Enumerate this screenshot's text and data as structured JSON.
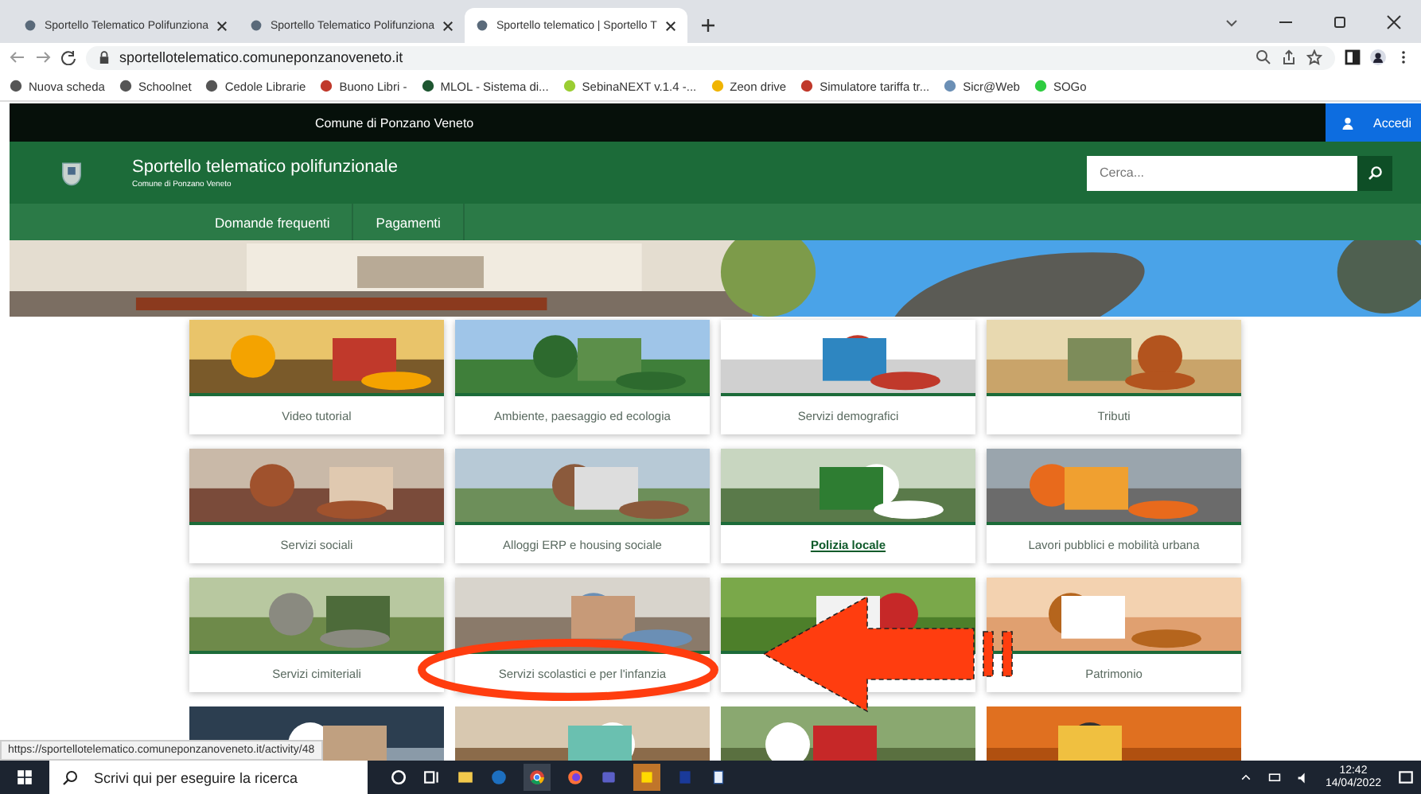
{
  "browser": {
    "tabs": [
      {
        "title": "Sportello Telematico Polifunziona",
        "selected": false
      },
      {
        "title": "Sportello Telematico Polifunziona",
        "selected": false
      },
      {
        "title": "Sportello telematico | Sportello T",
        "selected": true
      }
    ],
    "url": "sportellotelematico.comuneponzanoveneto.it",
    "bookmarks": [
      "Nuova scheda",
      "Schoolnet",
      "Cedole Librarie",
      "Buono Libri -",
      "MLOL - Sistema di...",
      "SebinaNEXT v.1.4 -...",
      "Zeon drive",
      "Simulatore tariffa tr...",
      "Sicr@Web",
      "SOGo"
    ]
  },
  "top_bar": {
    "title": "Comune di Ponzano Veneto",
    "login": "Accedi"
  },
  "header": {
    "title": "Sportello telematico polifunzionale",
    "subtitle": "Comune di Ponzano Veneto",
    "search": {
      "placeholder": "Cerca..."
    }
  },
  "nav": [
    "Domande frequenti",
    "Pagamenti"
  ],
  "tiles": [
    {
      "kind": "tile",
      "label": "Video tutorial",
      "hovered": false
    },
    {
      "kind": "tile",
      "label": "Ambiente, paesaggio ed ecologia",
      "hovered": false
    },
    {
      "kind": "tile",
      "label": "Servizi demografici",
      "hovered": false
    },
    {
      "kind": "tile",
      "label": "Tributi",
      "hovered": false
    },
    {
      "kind": "tile",
      "label": "Servizi sociali",
      "hovered": false
    },
    {
      "kind": "tile",
      "label": "Alloggi ERP e housing sociale",
      "hovered": false
    },
    {
      "kind": "tile",
      "label": "Polizia locale",
      "hovered": true
    },
    {
      "kind": "tile",
      "label": "Lavori pubblici e mobilità urbana",
      "hovered": false
    },
    {
      "kind": "tile",
      "label": "Servizi cimiteriali",
      "hovered": false
    },
    {
      "kind": "tile",
      "label": "Servizi scolastici e per l'infanzia",
      "hovered": false
    },
    {
      "kind": "tile"
    },
    {
      "kind": "tile",
      "label": "Patrimonio",
      "hovered": false
    },
    {
      "kind": "picture"
    },
    {
      "kind": "picture"
    },
    {
      "kind": "picture"
    },
    {
      "kind": "picture"
    }
  ],
  "status_url": "https://sportellotelematico.comuneponzanoveneto.it/activity/48",
  "taskbar": {
    "search": {
      "placeholder": "Scrivi qui per eseguire la ricerca"
    },
    "time": "12:42",
    "date": "14/04/2022"
  }
}
